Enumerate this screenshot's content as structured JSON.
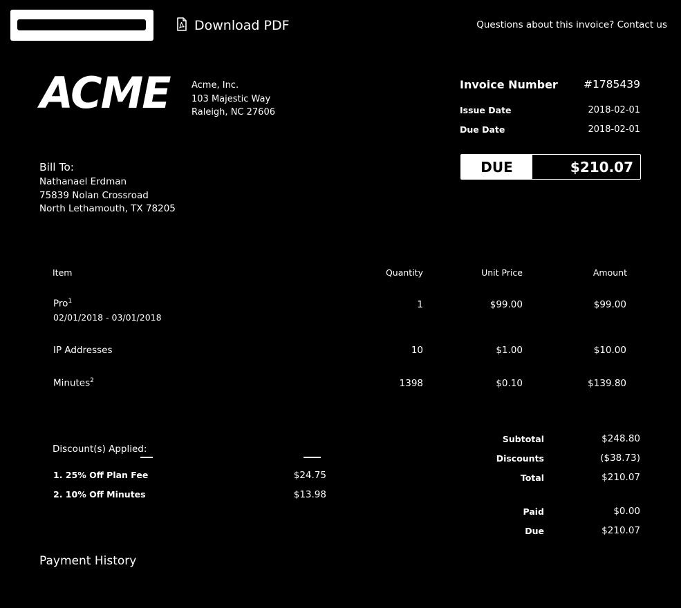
{
  "topbar": {
    "download_label": "Download PDF",
    "contact_text": "Questions about this invoice? Contact us"
  },
  "company": {
    "logo_text": "ACME",
    "name": "Acme, Inc.",
    "address1": "103 Majestic Way",
    "address2": "Raleigh, NC 27606"
  },
  "invoice": {
    "number_label": "Invoice Number",
    "number": "#1785439",
    "issue_label": "Issue Date",
    "issue_date": "2018-02-01",
    "due_label": "Due Date",
    "due_date": "2018-02-01",
    "due_badge_label": "DUE",
    "due_badge_amount": "$210.07"
  },
  "bill_to": {
    "title": "Bill To:",
    "name": "Nathanael Erdman",
    "street": "75839 Nolan Crossroad",
    "city": "North Lethamouth, TX 78205"
  },
  "table": {
    "headers": {
      "item": "Item",
      "quantity": "Quantity",
      "unit_price": "Unit Price",
      "amount": "Amount"
    },
    "rows": [
      {
        "item": "Pro",
        "sup": "1",
        "period": "02/01/2018 - 03/01/2018",
        "quantity": "1",
        "unit_price": "$99.00",
        "amount": "$99.00"
      },
      {
        "item": "IP Addresses",
        "sup": "",
        "period": "",
        "quantity": "10",
        "unit_price": "$1.00",
        "amount": "$10.00"
      },
      {
        "item": "Minutes",
        "sup": "2",
        "period": "",
        "quantity": "1398",
        "unit_price": "$0.10",
        "amount": "$139.80"
      }
    ]
  },
  "discounts": {
    "title": "Discount(s) Applied:",
    "items": [
      {
        "label": "1. 25% Off Plan Fee",
        "amount": "$24.75"
      },
      {
        "label": "2. 10% Off Minutes",
        "amount": "$13.98"
      }
    ]
  },
  "totals": {
    "subtotal_label": "Subtotal",
    "subtotal": "$248.80",
    "discounts_label": "Discounts",
    "discounts": "($38.73)",
    "total_label": "Total",
    "total": "$210.07",
    "paid_label": "Paid",
    "paid": "$0.00",
    "due_label": "Due",
    "due": "$210.07"
  },
  "payment_history": {
    "title": "Payment History"
  },
  "icons": {
    "download": "pdf-file-icon"
  }
}
